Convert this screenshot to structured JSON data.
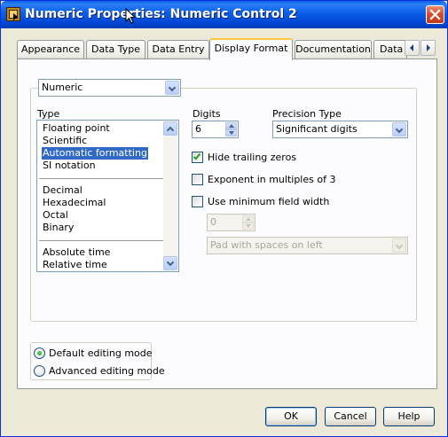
{
  "window": {
    "title": "Numeric Properties: Numeric Control 2"
  },
  "tabs": [
    {
      "label": "Appearance"
    },
    {
      "label": "Data Type"
    },
    {
      "label": "Data Entry"
    },
    {
      "label": "Display Format",
      "active": true
    },
    {
      "label": "Documentation"
    },
    {
      "label": "Data B"
    }
  ],
  "format_select": {
    "value": "Numeric"
  },
  "type_section": {
    "label": "Type",
    "items": [
      "Floating point",
      "Scientific",
      "Automatic formatting",
      "SI notation",
      "Decimal",
      "Hexadecimal",
      "Octal",
      "Binary",
      "Absolute time",
      "Relative time"
    ],
    "selected": "Automatic formatting"
  },
  "digits": {
    "label": "Digits",
    "value": "6"
  },
  "precision_type": {
    "label": "Precision Type",
    "value": "Significant digits"
  },
  "options": {
    "hide_trailing_zeros": {
      "label": "Hide trailing zeros",
      "checked": true
    },
    "exponent_multiples": {
      "label": "Exponent in multiples of 3",
      "checked": false
    },
    "min_field_width": {
      "label": "Use minimum field width",
      "checked": false
    }
  },
  "min_width": {
    "value": "0",
    "enabled": false
  },
  "padding": {
    "value": "Pad with spaces on left",
    "enabled": false
  },
  "editing_mode": {
    "default_label": "Default editing mode",
    "advanced_label": "Advanced editing mode",
    "selected": "default"
  },
  "buttons": {
    "ok": "OK",
    "cancel": "Cancel",
    "help": "Help"
  },
  "colors": {
    "titlebar": "#0a5de8",
    "selection": "#316ac5",
    "active_tab_accent": "#ffc83c",
    "check": "#21a121"
  }
}
